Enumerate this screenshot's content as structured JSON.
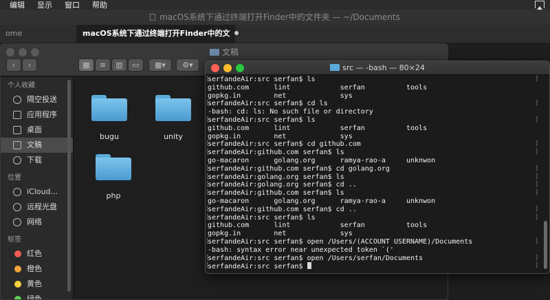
{
  "menubar": {
    "items": [
      "编辑",
      "显示",
      "窗口",
      "帮助"
    ]
  },
  "editor": {
    "title": "macOS系统下通过终端打开Finder中的文件夹 — ~/Documents",
    "tab_left": "ome",
    "tab_active": "macOS系统下通过终端打开Finder中的文"
  },
  "finder": {
    "title": "文稿",
    "sidebar": {
      "favorites_header": "个人收藏",
      "favorites": [
        "隔空投送",
        "应用程序",
        "桌面",
        "文稿",
        "下载"
      ],
      "locations_header": "位置",
      "locations": [
        "iCloud...",
        "远程光盘",
        "网络"
      ],
      "tags_header": "标签",
      "tags": [
        {
          "label": "红色",
          "color": "#ee5b54"
        },
        {
          "label": "橙色",
          "color": "#f2a33c"
        },
        {
          "label": "黄色",
          "color": "#f5d13a"
        },
        {
          "label": "绿色",
          "color": "#5fcd52"
        }
      ]
    },
    "folders": [
      "bugu",
      "unity",
      "php"
    ]
  },
  "terminal": {
    "title": "src — -bash — 80×24",
    "lines": [
      "serfandeAir:src serfan$ ls",
      "github.com      lint            serfan          tools",
      "gopkg.in        net             sys",
      "serfandeAir:src serfan$ cd ls",
      "-bash: cd: ls: No such file or directory",
      "serfandeAir:src serfan$ ls",
      "github.com      lint            serfan          tools",
      "gopkg.in        net             sys",
      "serfandeAir:src serfan$ cd github.com",
      "serfandeAir:github.com serfan$ ls",
      "go-macaron      golang.org      ramya-rao-a     unknwon",
      "serfandeAir:github.com serfan$ cd golang.org",
      "serfandeAir:golang.org serfan$ ls",
      "serfandeAir:golang.org serfan$ cd ..",
      "serfandeAir:github.com serfan$ ls",
      "go-macaron      golang.org      ramya-rao-a     unknwon",
      "serfandeAir:github.com serfan$ cd ..",
      "serfandeAir:src serfan$ ls",
      "github.com      lint            serfan          tools",
      "gopkg.in        net             sys",
      "serfandeAir:src serfan$ open /Users/(ACCOUNT USERNAME)/Documents",
      "-bash: syntax error near unexpected token `('",
      "serfandeAir:src serfan$ open /Users/serfan/Documents",
      "serfandeAir:src serfan$ "
    ]
  },
  "colors": {
    "close": "#fc5f57",
    "minimize": "#fdbc2e",
    "zoom": "#28c840",
    "folder": "#5aaad8"
  }
}
